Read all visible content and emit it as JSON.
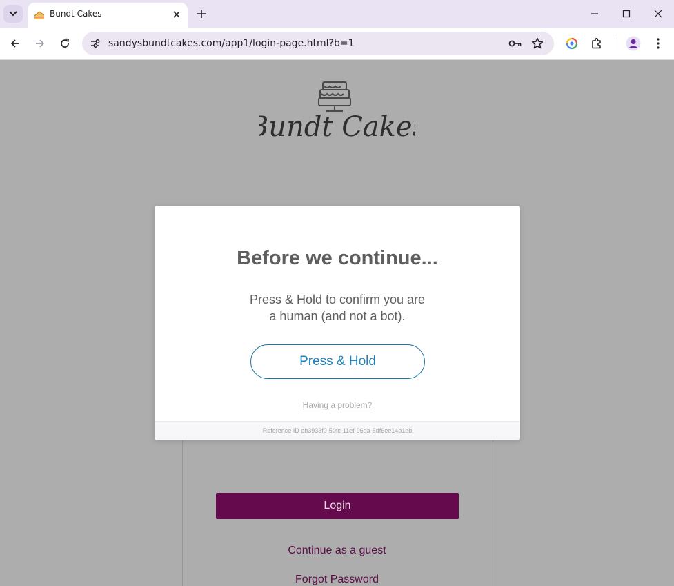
{
  "browser": {
    "tab_title": "Bundt Cakes",
    "url": "sandysbundtcakes.com/app1/login-page.html?b=1"
  },
  "page": {
    "login_label": "Login",
    "guest_link": "Continue as a guest",
    "forgot_link": "Forgot Password",
    "logo_text": "Bundt Cakes"
  },
  "modal": {
    "title": "Before we continue...",
    "text_line1": "Press & Hold to confirm you are",
    "text_line2": "a human (and not a bot).",
    "button_label": "Press & Hold",
    "problem_link": "Having a problem?",
    "reference_id": "Reference ID eb3933f0-50fc-11ef-96da-5df6ee14b1bb"
  },
  "colors": {
    "accent_purple": "#660a4e",
    "press_blue": "#1f81b9",
    "overlay_gray": "#adadad"
  },
  "icons": [
    "tab-dropdown-icon",
    "cake-favicon-icon",
    "close-tab-icon",
    "new-tab-icon",
    "minimize-icon",
    "maximize-icon",
    "close-window-icon",
    "back-icon",
    "forward-icon",
    "reload-icon",
    "site-info-icon",
    "password-key-icon",
    "bookmark-star-icon",
    "google-lens-icon",
    "extensions-icon",
    "profile-icon",
    "menu-icon"
  ]
}
